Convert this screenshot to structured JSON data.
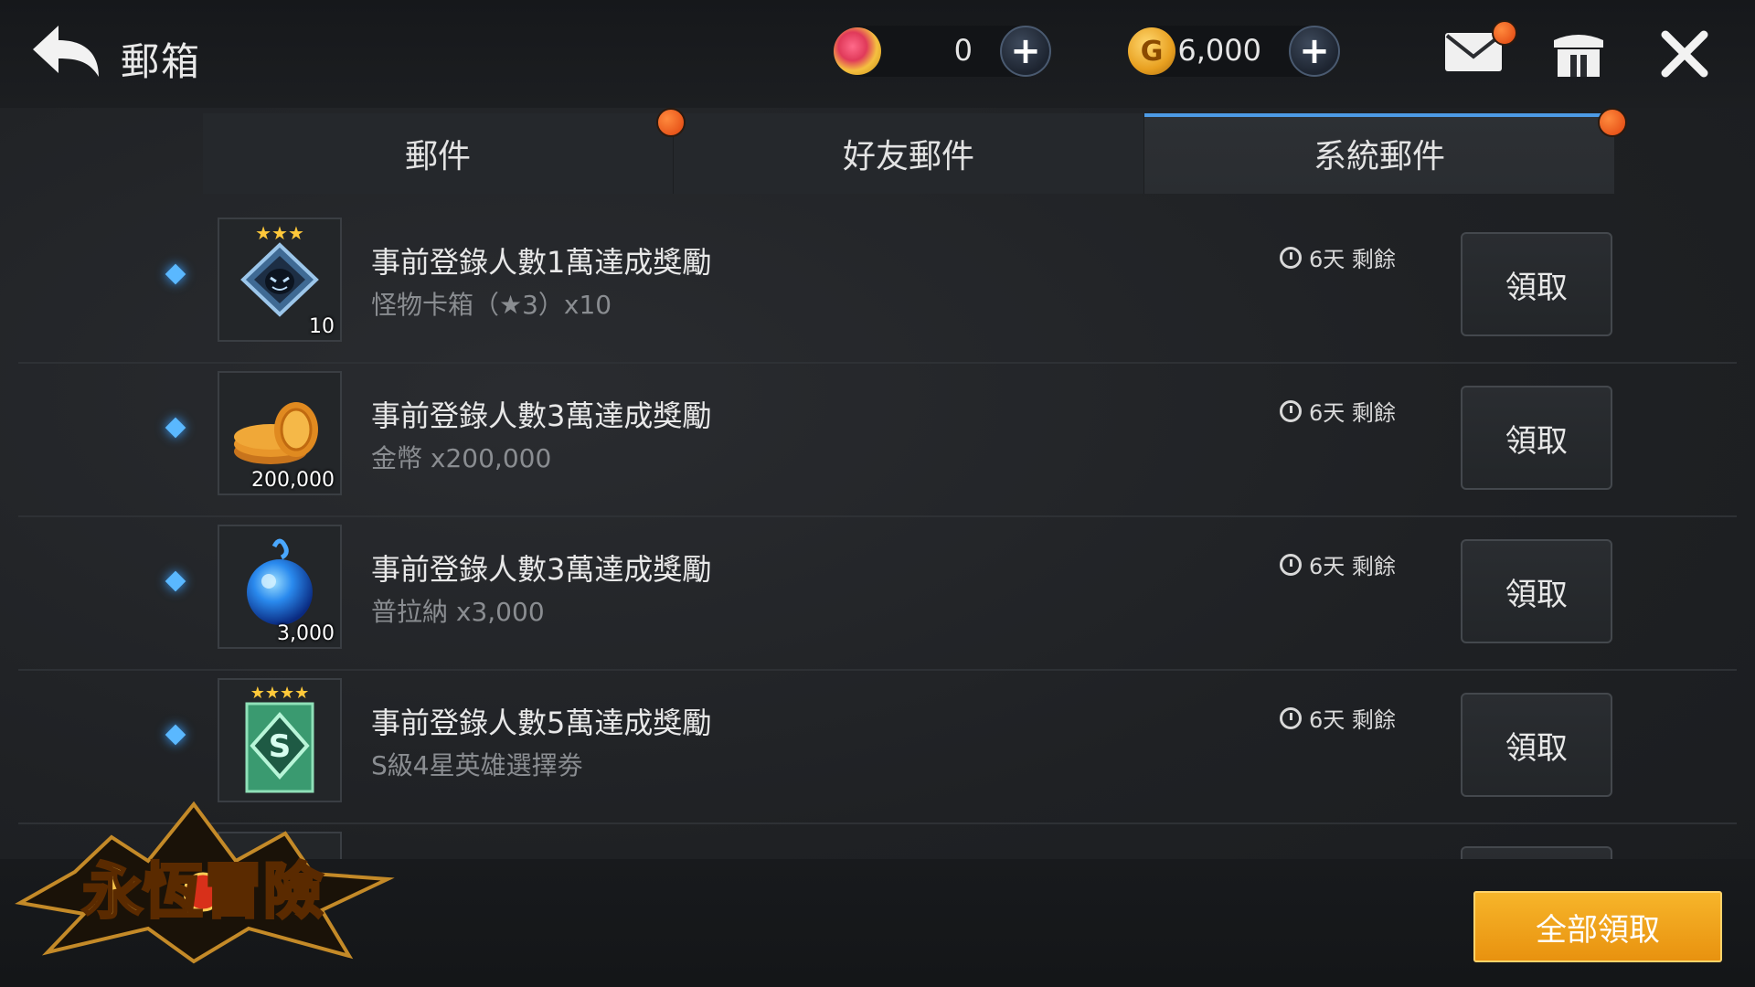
{
  "header": {
    "title": "郵箱",
    "currency1": {
      "icon": "gem-icon",
      "value": "0"
    },
    "currency2": {
      "icon": "gold-coin-icon",
      "value": "6,000"
    }
  },
  "tabs": [
    {
      "label": "郵件",
      "has_badge": true,
      "active": false
    },
    {
      "label": "好友郵件",
      "has_badge": false,
      "active": false
    },
    {
      "label": "系統郵件",
      "has_badge": true,
      "active": true
    }
  ],
  "mails": [
    {
      "title": "事前登錄人數1萬達成獎勵",
      "subtitle": "怪物卡箱（★3）x10",
      "quantity": "10",
      "remaining": "6天 剩餘",
      "claim_label": "領取",
      "icon": "monster-card-box-icon",
      "stars": 3
    },
    {
      "title": "事前登錄人數3萬達成獎勵",
      "subtitle": "金幣 x200,000",
      "quantity": "200,000",
      "remaining": "6天 剩餘",
      "claim_label": "領取",
      "icon": "gold-coins-icon",
      "stars": 0
    },
    {
      "title": "事前登錄人數3萬達成獎勵",
      "subtitle": "普拉納 x3,000",
      "quantity": "3,000",
      "remaining": "6天 剩餘",
      "claim_label": "領取",
      "icon": "prana-orb-icon",
      "stars": 0
    },
    {
      "title": "事前登錄人數5萬達成獎勵",
      "subtitle": "S級4星英雄選擇劵",
      "quantity": "",
      "remaining": "6天 剩餘",
      "claim_label": "領取",
      "icon": "s-rank-hero-ticket-icon",
      "stars": 4
    }
  ],
  "footer": {
    "claim_all_label": "全部領取",
    "logo_text": "永恆冒險"
  },
  "colors": {
    "accent_blue": "#4d9be6",
    "badge_orange": "#e0420e",
    "claim_all_gold": "#f0a21c"
  }
}
